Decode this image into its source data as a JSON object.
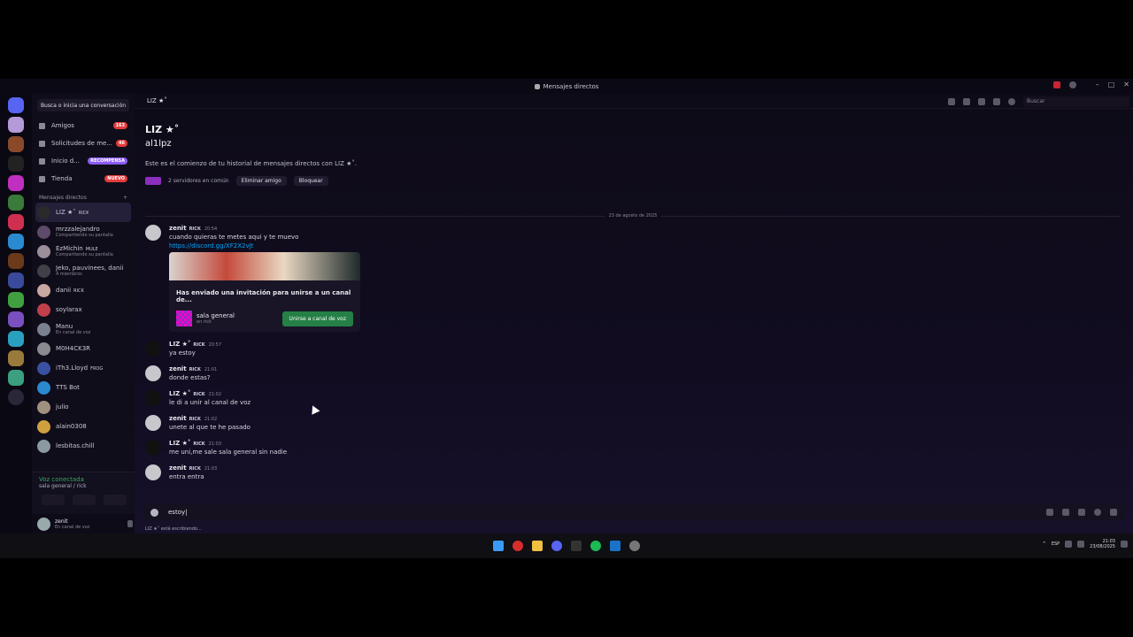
{
  "window": {
    "title": "Mensajes directos"
  },
  "sidebar": {
    "search_placeholder": "Busca o inicia una conversación",
    "nav": [
      {
        "label": "Amigos",
        "badge": "163"
      },
      {
        "label": "Solicitudes de me...",
        "badge": "46"
      },
      {
        "label": "Inicio d...",
        "badge": "RECOMPENSA"
      },
      {
        "label": "Tienda",
        "badge": "NUEVO"
      }
    ],
    "dm_header": "Mensajes directos",
    "dms": [
      {
        "name": "LIZ ★˚",
        "tag": "RICK",
        "sub": "",
        "color": "#2a2a2a"
      },
      {
        "name": "mrzzalejandro",
        "tag": "",
        "sub": "Compartiendo su pantalla",
        "color": "#5e4a6a"
      },
      {
        "name": "EzMichin",
        "tag": "MULE",
        "sub": "Compartiendo su pantalla",
        "color": "#9a8f9a"
      },
      {
        "name": "Jeko, pauvinees, danii",
        "tag": "",
        "sub": "4 miembros",
        "color": "#404048"
      },
      {
        "name": "danii",
        "tag": "RICK",
        "sub": "",
        "color": "#c8a8a0"
      },
      {
        "name": "soylarax",
        "tag": "",
        "sub": "",
        "color": "#c0404a"
      },
      {
        "name": "Manu",
        "tag": "",
        "sub": "En canal de voz",
        "color": "#7a8090"
      },
      {
        "name": "M0H4CK3R",
        "tag": "",
        "sub": "",
        "color": "#8a8a90"
      },
      {
        "name": "iTh3.Lloyd",
        "tag": "FROG",
        "sub": "",
        "color": "#3a50a0"
      },
      {
        "name": "TTS Bot",
        "tag": "",
        "sub": "",
        "color": "#2a8ad0"
      },
      {
        "name": "julio",
        "tag": "",
        "sub": "",
        "color": "#a09080"
      },
      {
        "name": "alain0308",
        "tag": "",
        "sub": "",
        "color": "#d0a040"
      },
      {
        "name": "lesbitas.chill",
        "tag": "",
        "sub": "",
        "color": "#8a9aa0"
      }
    ],
    "voice": {
      "title": "Voz conectada",
      "channel": "sala general / rick"
    },
    "user": {
      "name": "zenit",
      "status": "En canal de voz"
    }
  },
  "header": {
    "channel": "LIZ ★˚",
    "search": "Buscar"
  },
  "intro": {
    "display": "LIZ ★˚",
    "username": "al1lpz",
    "description": "Este es el comienzo de tu historial de mensajes directos con LIZ ★˚.",
    "servers": "2 servidores en común",
    "remove": "Eliminar amigo",
    "block": "Bloquear"
  },
  "date_separator": "23 de agosto de 2025",
  "messages": [
    {
      "author": "zenit",
      "tag": "RICK",
      "time": "20:54",
      "text": "cuando quieras te metes aqui y te muevo",
      "link": "https://discord.gg/XF2X2vJt",
      "avatar": "#c8c8cc"
    },
    {
      "author": "LIZ ★˚",
      "tag": "RICK",
      "time": "20:57",
      "text": "ya estoy",
      "avatar": "#111"
    },
    {
      "author": "zenit",
      "tag": "RICK",
      "time": "21:01",
      "text": "donde estas?",
      "avatar": "#c8c8cc"
    },
    {
      "author": "LIZ ★˚",
      "tag": "RICK",
      "time": "21:02",
      "text": "le di a unir al canal de voz",
      "avatar": "#111"
    },
    {
      "author": "zenit",
      "tag": "RICK",
      "time": "21:02",
      "text": "unete al que te he pasado",
      "avatar": "#c8c8cc"
    },
    {
      "author": "LIZ ★˚",
      "tag": "RICK",
      "time": "21:03",
      "text": "me uni,me sale sala general sin nadie",
      "avatar": "#111"
    },
    {
      "author": "zenit",
      "tag": "RICK",
      "time": "21:03",
      "text": "entra entra",
      "avatar": "#c8c8cc"
    }
  ],
  "invite": {
    "title": "Has enviado una invitación para unirse a un canal de...",
    "channel": "sala general",
    "server": "en rick",
    "button": "Unirse a canal de voz"
  },
  "composer": {
    "value": "estoy|"
  },
  "typing": "LIZ ★˚ está escribiendo...",
  "taskbar": {
    "lang": "ESP",
    "time": "21:03",
    "date": "23/08/2025"
  }
}
